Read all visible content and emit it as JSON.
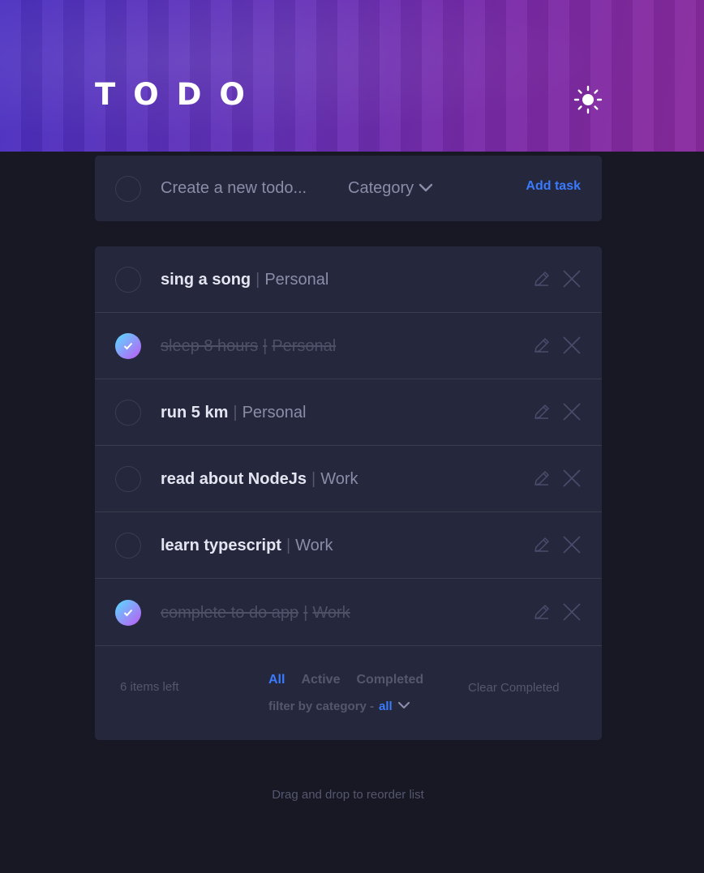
{
  "header": {
    "title": "TODO",
    "theme_icon": "sun-icon"
  },
  "new_todo": {
    "placeholder": "Create a new todo...",
    "category_label": "Category",
    "add_label": "Add task"
  },
  "todos": [
    {
      "task": "sing a song",
      "separator": "|",
      "category": "Personal",
      "completed": false
    },
    {
      "task": "sleep 8 hours",
      "separator": "|",
      "category": "Personal",
      "completed": true
    },
    {
      "task": "run 5 km",
      "separator": "|",
      "category": "Personal",
      "completed": false
    },
    {
      "task": "read about NodeJs",
      "separator": "|",
      "category": "Work",
      "completed": false
    },
    {
      "task": "learn typescript",
      "separator": "|",
      "category": "Work",
      "completed": false
    },
    {
      "task": "complete to do app",
      "separator": "|",
      "category": "Work",
      "completed": true
    }
  ],
  "footer": {
    "items_left": "6 items left",
    "filters": [
      "All",
      "Active",
      "Completed"
    ],
    "active_filter": "All",
    "category_filter_label": "filter by category -",
    "category_filter_value": "all",
    "clear_label": "Clear Completed"
  },
  "hint": "Drag and drop to reorder list",
  "colors": {
    "background": "#181824",
    "card": "#25273c",
    "accent": "#3a7bfd",
    "check_gradient_start": "#57ddff",
    "check_gradient_end": "#c058f3"
  }
}
